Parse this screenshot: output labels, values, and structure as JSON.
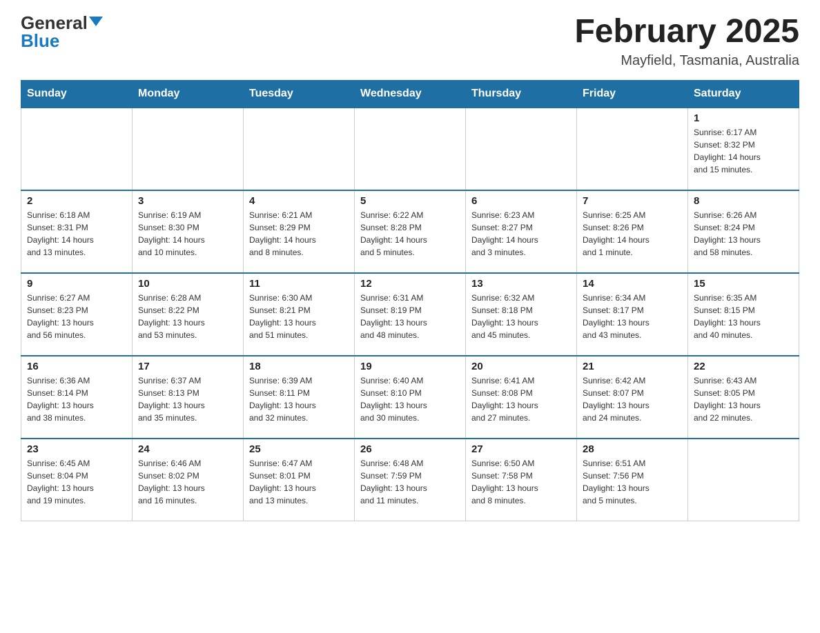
{
  "header": {
    "logo_general": "General",
    "logo_blue": "Blue",
    "month_title": "February 2025",
    "location": "Mayfield, Tasmania, Australia"
  },
  "weekdays": [
    "Sunday",
    "Monday",
    "Tuesday",
    "Wednesday",
    "Thursday",
    "Friday",
    "Saturday"
  ],
  "weeks": [
    [
      {
        "day": "",
        "info": ""
      },
      {
        "day": "",
        "info": ""
      },
      {
        "day": "",
        "info": ""
      },
      {
        "day": "",
        "info": ""
      },
      {
        "day": "",
        "info": ""
      },
      {
        "day": "",
        "info": ""
      },
      {
        "day": "1",
        "info": "Sunrise: 6:17 AM\nSunset: 8:32 PM\nDaylight: 14 hours\nand 15 minutes."
      }
    ],
    [
      {
        "day": "2",
        "info": "Sunrise: 6:18 AM\nSunset: 8:31 PM\nDaylight: 14 hours\nand 13 minutes."
      },
      {
        "day": "3",
        "info": "Sunrise: 6:19 AM\nSunset: 8:30 PM\nDaylight: 14 hours\nand 10 minutes."
      },
      {
        "day": "4",
        "info": "Sunrise: 6:21 AM\nSunset: 8:29 PM\nDaylight: 14 hours\nand 8 minutes."
      },
      {
        "day": "5",
        "info": "Sunrise: 6:22 AM\nSunset: 8:28 PM\nDaylight: 14 hours\nand 5 minutes."
      },
      {
        "day": "6",
        "info": "Sunrise: 6:23 AM\nSunset: 8:27 PM\nDaylight: 14 hours\nand 3 minutes."
      },
      {
        "day": "7",
        "info": "Sunrise: 6:25 AM\nSunset: 8:26 PM\nDaylight: 14 hours\nand 1 minute."
      },
      {
        "day": "8",
        "info": "Sunrise: 6:26 AM\nSunset: 8:24 PM\nDaylight: 13 hours\nand 58 minutes."
      }
    ],
    [
      {
        "day": "9",
        "info": "Sunrise: 6:27 AM\nSunset: 8:23 PM\nDaylight: 13 hours\nand 56 minutes."
      },
      {
        "day": "10",
        "info": "Sunrise: 6:28 AM\nSunset: 8:22 PM\nDaylight: 13 hours\nand 53 minutes."
      },
      {
        "day": "11",
        "info": "Sunrise: 6:30 AM\nSunset: 8:21 PM\nDaylight: 13 hours\nand 51 minutes."
      },
      {
        "day": "12",
        "info": "Sunrise: 6:31 AM\nSunset: 8:19 PM\nDaylight: 13 hours\nand 48 minutes."
      },
      {
        "day": "13",
        "info": "Sunrise: 6:32 AM\nSunset: 8:18 PM\nDaylight: 13 hours\nand 45 minutes."
      },
      {
        "day": "14",
        "info": "Sunrise: 6:34 AM\nSunset: 8:17 PM\nDaylight: 13 hours\nand 43 minutes."
      },
      {
        "day": "15",
        "info": "Sunrise: 6:35 AM\nSunset: 8:15 PM\nDaylight: 13 hours\nand 40 minutes."
      }
    ],
    [
      {
        "day": "16",
        "info": "Sunrise: 6:36 AM\nSunset: 8:14 PM\nDaylight: 13 hours\nand 38 minutes."
      },
      {
        "day": "17",
        "info": "Sunrise: 6:37 AM\nSunset: 8:13 PM\nDaylight: 13 hours\nand 35 minutes."
      },
      {
        "day": "18",
        "info": "Sunrise: 6:39 AM\nSunset: 8:11 PM\nDaylight: 13 hours\nand 32 minutes."
      },
      {
        "day": "19",
        "info": "Sunrise: 6:40 AM\nSunset: 8:10 PM\nDaylight: 13 hours\nand 30 minutes."
      },
      {
        "day": "20",
        "info": "Sunrise: 6:41 AM\nSunset: 8:08 PM\nDaylight: 13 hours\nand 27 minutes."
      },
      {
        "day": "21",
        "info": "Sunrise: 6:42 AM\nSunset: 8:07 PM\nDaylight: 13 hours\nand 24 minutes."
      },
      {
        "day": "22",
        "info": "Sunrise: 6:43 AM\nSunset: 8:05 PM\nDaylight: 13 hours\nand 22 minutes."
      }
    ],
    [
      {
        "day": "23",
        "info": "Sunrise: 6:45 AM\nSunset: 8:04 PM\nDaylight: 13 hours\nand 19 minutes."
      },
      {
        "day": "24",
        "info": "Sunrise: 6:46 AM\nSunset: 8:02 PM\nDaylight: 13 hours\nand 16 minutes."
      },
      {
        "day": "25",
        "info": "Sunrise: 6:47 AM\nSunset: 8:01 PM\nDaylight: 13 hours\nand 13 minutes."
      },
      {
        "day": "26",
        "info": "Sunrise: 6:48 AM\nSunset: 7:59 PM\nDaylight: 13 hours\nand 11 minutes."
      },
      {
        "day": "27",
        "info": "Sunrise: 6:50 AM\nSunset: 7:58 PM\nDaylight: 13 hours\nand 8 minutes."
      },
      {
        "day": "28",
        "info": "Sunrise: 6:51 AM\nSunset: 7:56 PM\nDaylight: 13 hours\nand 5 minutes."
      },
      {
        "day": "",
        "info": ""
      }
    ]
  ]
}
